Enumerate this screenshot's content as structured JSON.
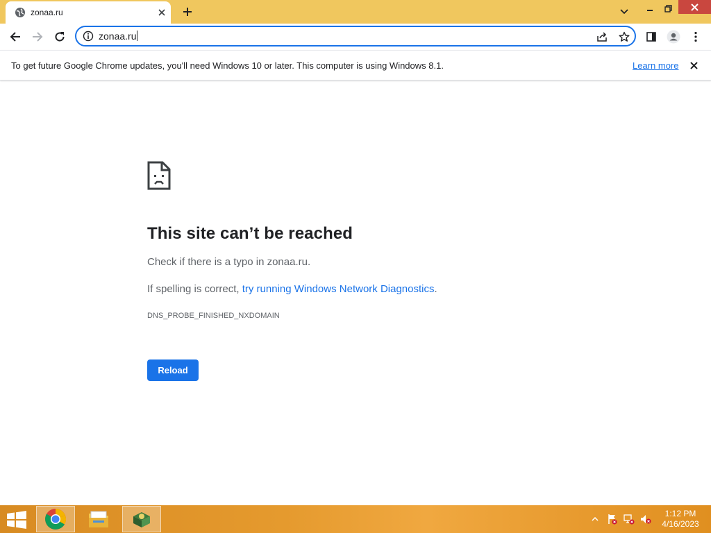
{
  "tab": {
    "title": "zonaa.ru"
  },
  "omnibox": {
    "url": "zonaa.ru"
  },
  "infobar": {
    "message": "To get future Google Chrome updates, you'll need Windows 10 or later. This computer is using Windows 8.1.",
    "link": "Learn more"
  },
  "error": {
    "title": "This site can’t be reached",
    "line1": "Check if there is a typo in zonaa.ru.",
    "line2_prefix": "If spelling is correct, ",
    "line2_link": "try running Windows Network Diagnostics",
    "line2_suffix": ".",
    "code": "DNS_PROBE_FINISHED_NXDOMAIN",
    "reload_label": "Reload"
  },
  "taskbar": {
    "apps": [
      "chrome-icon",
      "file-explorer-icon",
      "app-icon"
    ],
    "clock": {
      "time": "1:12 PM",
      "date": "4/16/2023"
    }
  },
  "colors": {
    "tabstrip": "#f0c75e",
    "accent": "#1a73e8",
    "taskbar": "#e59a2e"
  }
}
